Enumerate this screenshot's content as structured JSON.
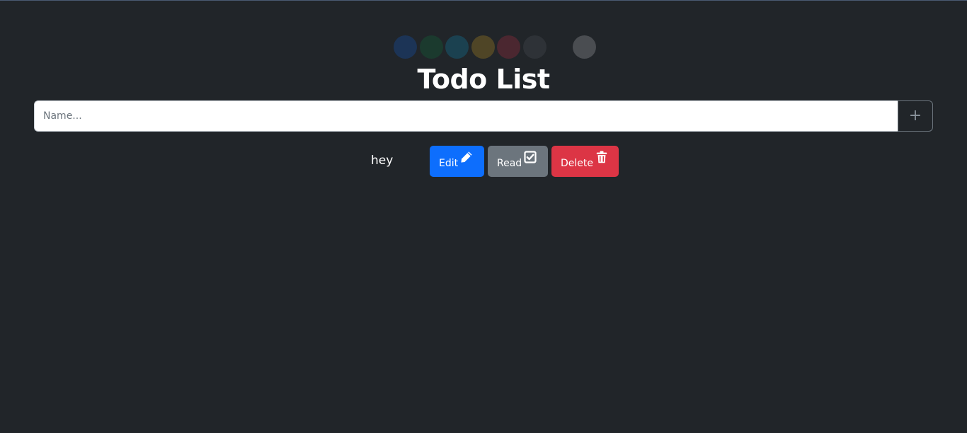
{
  "theme_swatches": [
    {
      "name": "blue",
      "color": "#1c3456"
    },
    {
      "name": "green",
      "color": "#1b3a2e"
    },
    {
      "name": "cyan",
      "color": "#1b4150"
    },
    {
      "name": "yellow",
      "color": "#4f4526"
    },
    {
      "name": "red",
      "color": "#4b2730"
    },
    {
      "name": "dark",
      "color": "#2e3237"
    },
    {
      "name": "gray",
      "color": "#4a4d51"
    }
  ],
  "header": {
    "title": "Todo List"
  },
  "new_todo": {
    "placeholder": "Name...",
    "value": "",
    "add_label": "+"
  },
  "todos": [
    {
      "text": "hey",
      "edit_label": "Edit",
      "read_label": "Read",
      "delete_label": "Delete"
    }
  ],
  "colors": {
    "background": "#212529",
    "edit": "#0d6efd",
    "read": "#6c757d",
    "delete": "#dc3545"
  },
  "icons": {
    "edit": "pencil-icon",
    "read": "check-square-icon",
    "delete": "trash-icon"
  }
}
